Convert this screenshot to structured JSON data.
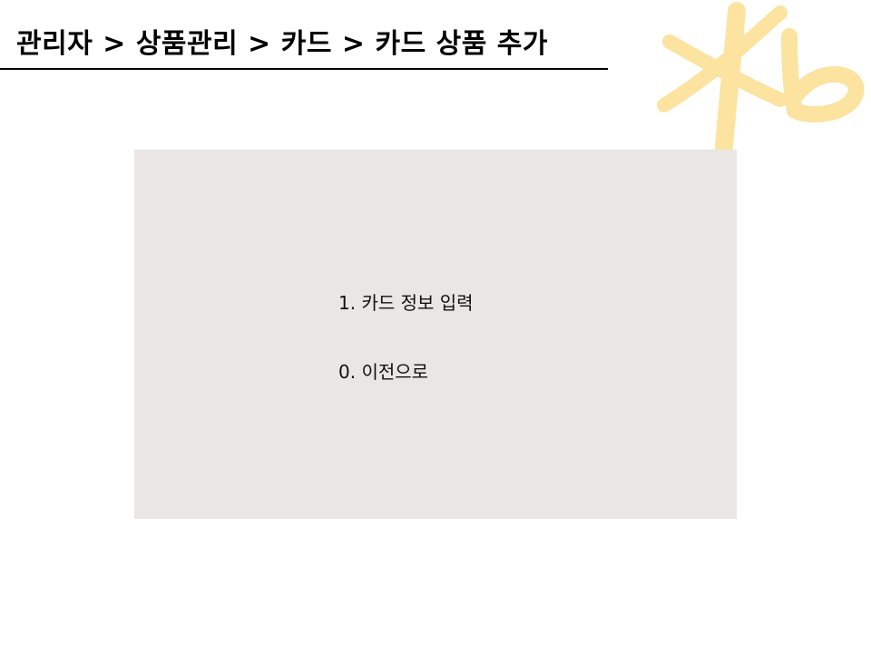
{
  "header": {
    "breadcrumb": "관리자 > 상품관리 > 카드 > 카드 상품 추가"
  },
  "logo": {
    "name": "kb-logo",
    "text": "Kb",
    "color": "#fde3a0"
  },
  "menu": {
    "background": "#e9e6e3",
    "items": [
      {
        "label": "1. 카드 정보 입력"
      },
      {
        "label": "0. 이전으로"
      }
    ]
  }
}
